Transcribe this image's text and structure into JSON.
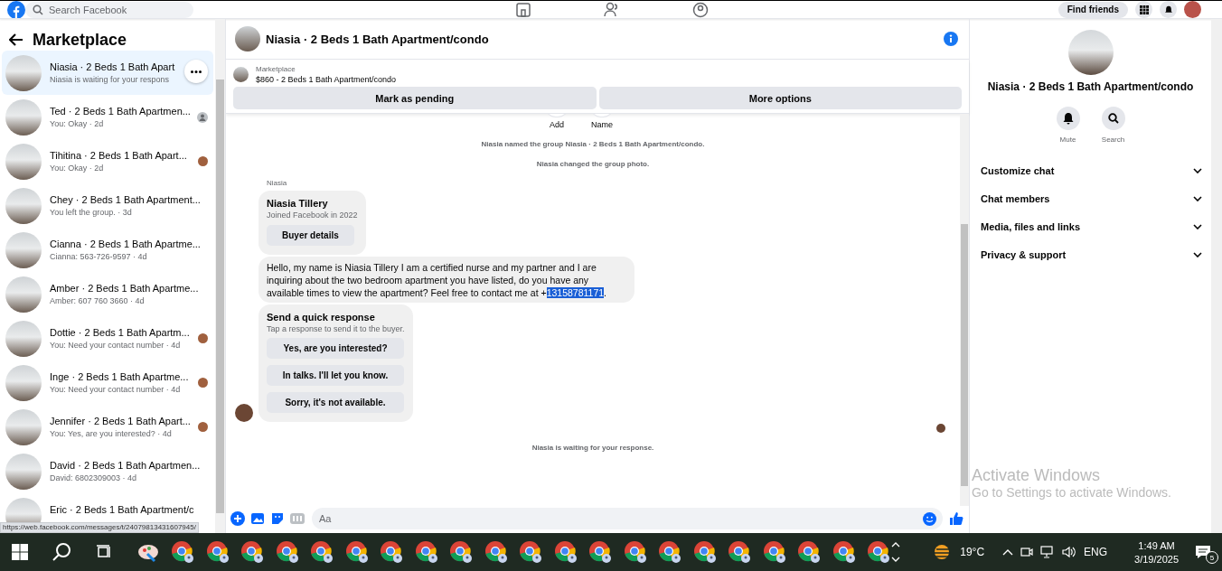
{
  "top_bar": {
    "search": {
      "placeholder": "Search Facebook"
    },
    "find_friends": "Find friends"
  },
  "sidebar": {
    "title": "Marketplace",
    "conversations": [
      {
        "name": "Niasia · 2 Beds 1 Bath Apart",
        "preview": "Niasia is waiting for your respons",
        "selected": true,
        "kind": "plain"
      },
      {
        "name": "Ted · 2 Beds 1 Bath Apartmen...",
        "preview": "You: Okay · 2d",
        "selected": false,
        "kind": "seen_silhouette"
      },
      {
        "name": "Tihitina · 2 Beds 1 Bath Apart...",
        "preview": "You: Okay · 2d",
        "selected": false,
        "kind": "seen_photo"
      },
      {
        "name": "Chey · 2 Beds 1 Bath Apartment...",
        "preview": "You left the group. · 3d",
        "selected": false,
        "kind": "plain"
      },
      {
        "name": "Cianna · 2 Beds 1 Bath Apartme...",
        "preview": "Cianna: 563-726-9597 · 4d",
        "selected": false,
        "kind": "plain"
      },
      {
        "name": "Amber · 2 Beds 1 Bath Apartme...",
        "preview": "Amber: 607 760 3660 · 4d",
        "selected": false,
        "kind": "plain"
      },
      {
        "name": "Dottie · 2 Beds 1 Bath Apartm...",
        "preview": "You: Need your contact number · 4d",
        "selected": false,
        "kind": "seen_photo"
      },
      {
        "name": "Inge · 2 Beds 1 Bath Apartme...",
        "preview": "You: Need your contact number · 4d",
        "selected": false,
        "kind": "seen_photo"
      },
      {
        "name": "Jennifer · 2 Beds 1 Bath Apart...",
        "preview": "You: Yes, are you interested? · 4d",
        "selected": false,
        "kind": "seen_photo"
      },
      {
        "name": "David · 2 Beds 1 Bath Apartmen...",
        "preview": "David: 6802309003 · 4d",
        "selected": false,
        "kind": "plain"
      },
      {
        "name": "Eric · 2 Beds 1 Bath Apartment/c",
        "selected": false,
        "kind": "plain"
      }
    ],
    "status_url": "https://web.facebook.com/messages/t/24079813431607945/"
  },
  "chat": {
    "title": "Niasia · 2 Beds 1 Bath Apartment/condo",
    "listing": {
      "label": "Marketplace",
      "text": "$860 - 2 Beds 1 Bath Apartment/condo"
    },
    "actions": [
      "Mark as pending",
      "More options"
    ],
    "group_actions": [
      "Add",
      "Name"
    ],
    "notices": [
      "Niasia named the group Niasia · 2 Beds 1 Bath Apartment/condo.",
      "Niasia changed the group photo."
    ],
    "sender": "Niasia",
    "buyer_card": {
      "name": "Niasia Tillery",
      "joined": "Joined Facebook in 2022",
      "button": "Buyer details"
    },
    "message": {
      "text": "Hello, my name is Niasia Tillery I am a certified nurse and my partner and I are inquiring about the two bedroom apartment you have listed, do you have any available times to view the apartment? Feel free to contact me at +",
      "selected_text": "13158781171",
      "text_after": "."
    },
    "quick_response": {
      "title": "Send a quick response",
      "hint": "Tap a response to send it to the buyer.",
      "options": [
        "Yes, are you interested?",
        "In talks. I'll let you know.",
        "Sorry, it's not available."
      ]
    },
    "waiting": "Niasia is waiting for your response.",
    "composer": {
      "placeholder": "Aa"
    }
  },
  "details": {
    "title": "Niasia · 2 Beds 1 Bath Apartment/condo",
    "buttons": [
      "Mute",
      "Search"
    ],
    "sections": [
      "Customize chat",
      "Chat members",
      "Media, files and links",
      "Privacy & support"
    ]
  },
  "activation": {
    "title": "Activate Windows",
    "text": "Go to Settings to activate Windows."
  },
  "taskbar": {
    "apps": [
      {
        "kind": "paint"
      },
      {
        "kind": "browser"
      },
      {
        "kind": "browser"
      },
      {
        "kind": "browser"
      },
      {
        "kind": "browser"
      },
      {
        "kind": "browser"
      },
      {
        "kind": "browser"
      },
      {
        "kind": "browser"
      },
      {
        "kind": "browser"
      },
      {
        "kind": "browser"
      },
      {
        "kind": "browser"
      },
      {
        "kind": "browser"
      },
      {
        "kind": "browser"
      },
      {
        "kind": "browser"
      },
      {
        "kind": "browser"
      },
      {
        "kind": "browser"
      },
      {
        "kind": "browser"
      },
      {
        "kind": "browser"
      },
      {
        "kind": "browser"
      },
      {
        "kind": "browser"
      },
      {
        "kind": "browser"
      },
      {
        "kind": "browser"
      }
    ],
    "weather": "19°C",
    "language": "ENG",
    "time": "1:49 AM",
    "date": "3/19/2025",
    "notifications": "5"
  }
}
